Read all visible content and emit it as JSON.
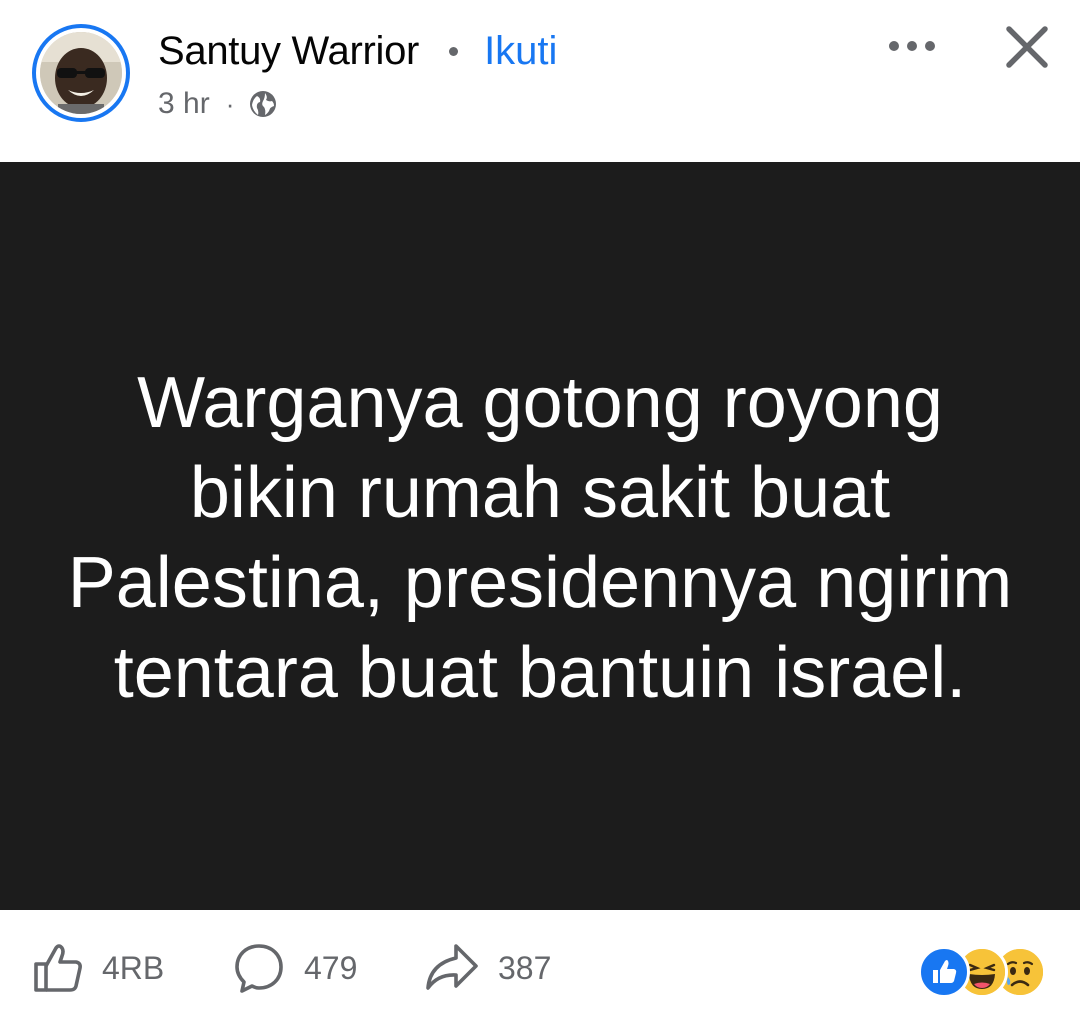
{
  "author": {
    "name": "Santuy Warrior",
    "follow_label": "Ikuti"
  },
  "meta": {
    "time": "3 hr",
    "separator": "·",
    "audience_icon": "globe-icon"
  },
  "header_actions": {
    "more_icon": "more-horizontal-icon",
    "close_icon": "close-icon"
  },
  "post": {
    "text": "Warganya gotong royong bikin rumah sakit buat Palestina, presidennya ngirim tentara buat bantuin israel.",
    "background_color": "#1c1c1c",
    "text_color": "#ffffff"
  },
  "footer": {
    "likes": "4RB",
    "comments": "479",
    "shares": "387",
    "reactions": [
      "like",
      "haha",
      "sad"
    ]
  },
  "colors": {
    "accent": "#1877f2",
    "muted": "#65676b"
  }
}
